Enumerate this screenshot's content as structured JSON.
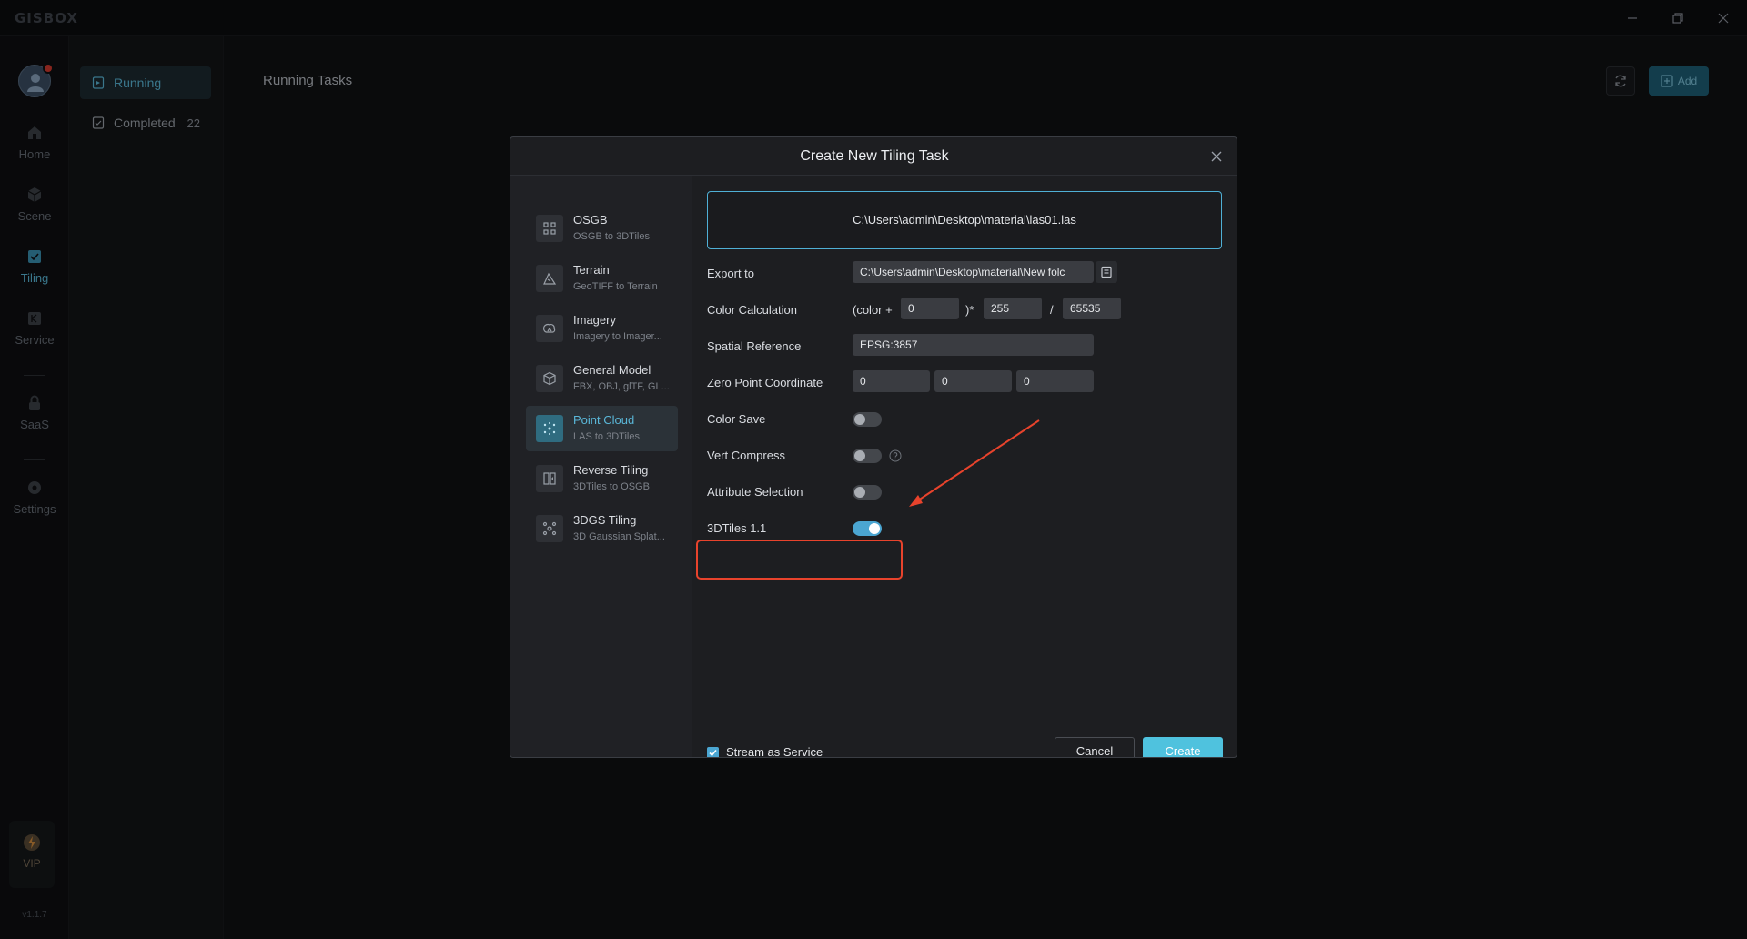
{
  "app": {
    "brand": "GISBOX",
    "version": "v1.1.7"
  },
  "rail": {
    "items": [
      {
        "label": "Home",
        "icon": "home-icon"
      },
      {
        "label": "Scene",
        "icon": "cube-icon"
      },
      {
        "label": "Tiling",
        "icon": "tiling-icon"
      },
      {
        "label": "Service",
        "icon": "service-icon"
      },
      {
        "label": "SaaS",
        "icon": "lock-icon"
      },
      {
        "label": "Settings",
        "icon": "gear-icon"
      }
    ],
    "vip": "VIP"
  },
  "subnav": {
    "running": "Running",
    "completed": "Completed",
    "completed_count": "22"
  },
  "main": {
    "title": "Running Tasks",
    "add_label": "Add"
  },
  "modal": {
    "title": "Create New Tiling Task",
    "types": [
      {
        "name": "OSGB",
        "desc": "OSGB to 3DTiles"
      },
      {
        "name": "Terrain",
        "desc": "GeoTIFF to Terrain"
      },
      {
        "name": "Imagery",
        "desc": "Imagery to Imager..."
      },
      {
        "name": "General Model",
        "desc": "FBX, OBJ, glTF, GL..."
      },
      {
        "name": "Point Cloud",
        "desc": "LAS to 3DTiles"
      },
      {
        "name": "Reverse Tiling",
        "desc": "3DTiles to OSGB"
      },
      {
        "name": "3DGS Tiling",
        "desc": "3D Gaussian Splat..."
      }
    ],
    "active_type": "Point Cloud",
    "file_path": "C:\\Users\\admin\\Desktop\\material\\las01.las",
    "export_label": "Export to",
    "export_value": "C:\\Users\\admin\\Desktop\\material\\New folc",
    "color_calc": {
      "label": "Color Calculation",
      "prefix": "(color +",
      "offset": "0",
      "mid": ")*",
      "multiplier": "255",
      "slash": "/",
      "divisor": "65535"
    },
    "spatial_label": "Spatial Reference",
    "spatial_value": "EPSG:3857",
    "zero_label": "Zero Point Coordinate",
    "zero_values": [
      "0",
      "0",
      "0"
    ],
    "color_save_label": "Color Save",
    "color_save": false,
    "vert_compress_label": "Vert Compress",
    "vert_compress": false,
    "attr_selection_label": "Attribute Selection",
    "attr_selection": false,
    "tiles11_label": "3DTiles 1.1",
    "tiles11": true,
    "stream_label": "Stream as Service",
    "stream_checked": true,
    "cancel_label": "Cancel",
    "create_label": "Create"
  },
  "colors": {
    "accent": "#4fc2de",
    "highlight": "#e8432c",
    "toggle_on": "#4ba6d2"
  }
}
